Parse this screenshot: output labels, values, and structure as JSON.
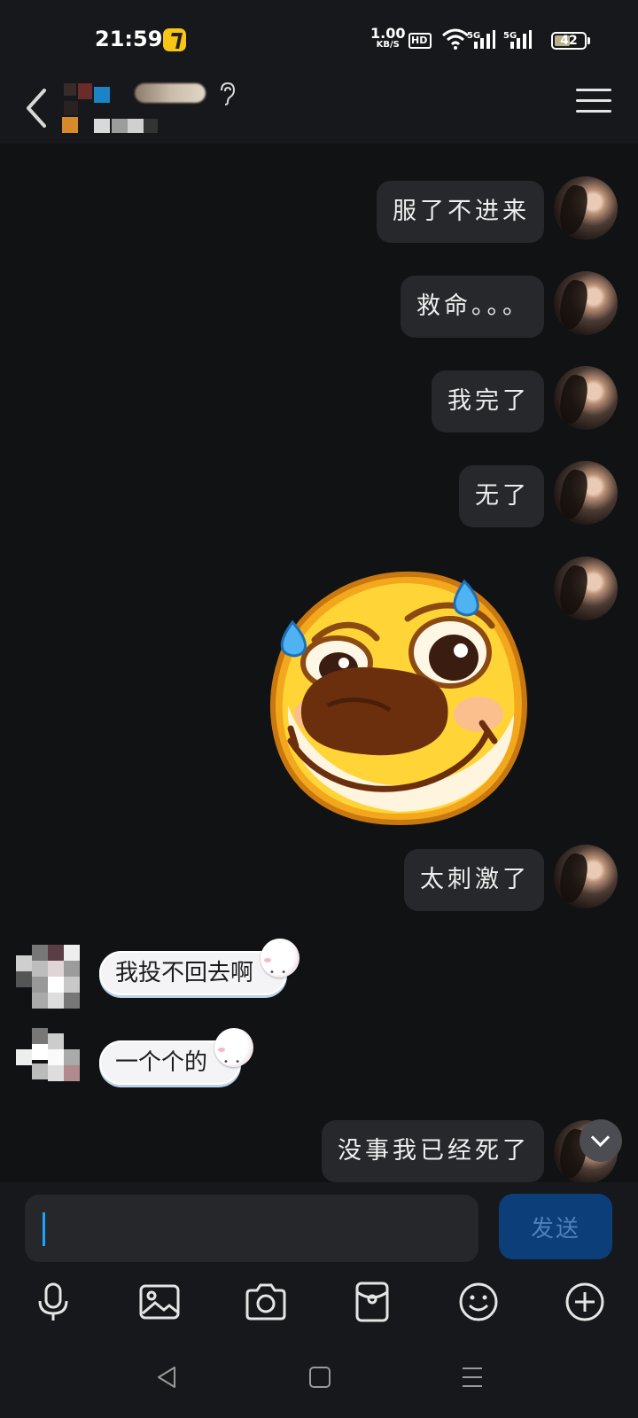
{
  "status_bar": {
    "time": "21:59",
    "network_speed": "1.00",
    "network_speed_unit": "KB/S",
    "hd_label": "HD",
    "network_1": "5G",
    "network_2": "5G",
    "battery": "42"
  },
  "header": {
    "back_icon": "chevron-left-icon",
    "menu_icon": "hamburger-menu-icon",
    "earpiece_icon": "ear-icon"
  },
  "messages": [
    {
      "side": "out",
      "text": "服了不进来"
    },
    {
      "side": "out",
      "text": "救命。。。"
    },
    {
      "side": "out",
      "text": "我完了"
    },
    {
      "side": "out",
      "text": "无了"
    },
    {
      "side": "out",
      "type": "sticker",
      "sticker": "sweating-smiling-face-sticker"
    },
    {
      "side": "out",
      "text": "太刺激了"
    },
    {
      "side": "in",
      "text": "我投不回去啊"
    },
    {
      "side": "in",
      "text": "一个个的"
    },
    {
      "side": "out",
      "text": "没事我已经死了"
    }
  ],
  "composer": {
    "input_value": "",
    "send_label": "发送"
  },
  "toolbar": [
    "microphone-icon",
    "image-icon",
    "camera-icon",
    "red-packet-icon",
    "emoji-icon",
    "plus-icon"
  ],
  "navigation": [
    "back-triangle-icon",
    "home-square-icon",
    "recents-menu-icon"
  ],
  "colors": {
    "background": "#111214",
    "bubble_out": "#26282c",
    "send_button": "#0c3f7a",
    "caret": "#1aa3ff"
  }
}
